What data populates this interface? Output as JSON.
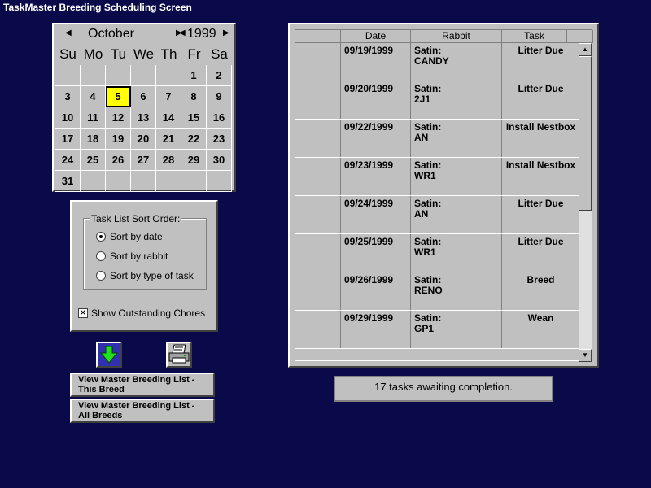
{
  "window": {
    "title": "TaskMaster Breeding Scheduling Screen"
  },
  "calendar": {
    "month": "October",
    "year": "1999",
    "weekdays": [
      "Su",
      "Mo",
      "Tu",
      "We",
      "Th",
      "Fr",
      "Sa"
    ],
    "weeks": [
      [
        "",
        "",
        "",
        "",
        "",
        "1",
        "2"
      ],
      [
        "3",
        "4",
        "5",
        "6",
        "7",
        "8",
        "9"
      ],
      [
        "10",
        "11",
        "12",
        "13",
        "14",
        "15",
        "16"
      ],
      [
        "17",
        "18",
        "19",
        "20",
        "21",
        "22",
        "23"
      ],
      [
        "24",
        "25",
        "26",
        "27",
        "28",
        "29",
        "30"
      ],
      [
        "31",
        "",
        "",
        "",
        "",
        "",
        ""
      ]
    ],
    "selected_day": "5"
  },
  "sort_options": {
    "group_label": "Task List Sort Order:",
    "options": [
      "Sort by date",
      "Sort by rabbit",
      "Sort by type of task"
    ],
    "selected_index": 0
  },
  "outstanding": {
    "label": "Show Outstanding Chores",
    "checked": true
  },
  "buttons": {
    "this_breed": [
      "View Master Breeding List -",
      "This Breed"
    ],
    "all_breeds": [
      "View Master Breeding List -",
      "All Breeds"
    ]
  },
  "task_table": {
    "columns": [
      "",
      "Date",
      "Rabbit",
      "Task"
    ],
    "rows": [
      {
        "date": "09/19/1999",
        "rabbit": [
          "Satin:",
          "CANDY"
        ],
        "task": "Litter Due"
      },
      {
        "date": "09/20/1999",
        "rabbit": [
          "Satin:",
          "2J1"
        ],
        "task": "Litter Due"
      },
      {
        "date": "09/22/1999",
        "rabbit": [
          "Satin:",
          "AN"
        ],
        "task": "Install Nestbox"
      },
      {
        "date": "09/23/1999",
        "rabbit": [
          "Satin:",
          "WR1"
        ],
        "task": "Install Nestbox"
      },
      {
        "date": "09/24/1999",
        "rabbit": [
          "Satin:",
          "AN"
        ],
        "task": "Litter Due"
      },
      {
        "date": "09/25/1999",
        "rabbit": [
          "Satin:",
          "WR1"
        ],
        "task": "Litter Due"
      },
      {
        "date": "09/26/1999",
        "rabbit": [
          "Satin:",
          "RENO"
        ],
        "task": "Breed"
      },
      {
        "date": "09/29/1999",
        "rabbit": [
          "Satin:",
          "GP1"
        ],
        "task": "Wean"
      }
    ]
  },
  "status": {
    "text": "17 tasks awaiting completion."
  }
}
